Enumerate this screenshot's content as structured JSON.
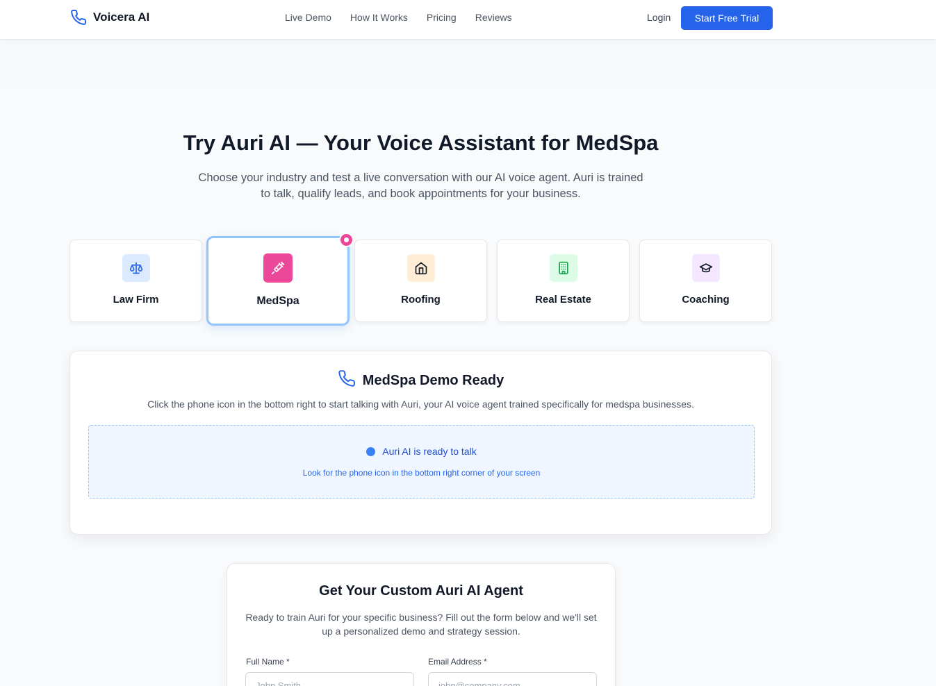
{
  "header": {
    "brand": "Voicera AI",
    "nav": [
      "Live Demo",
      "How It Works",
      "Pricing",
      "Reviews"
    ],
    "login": "Login",
    "cta": "Start Free Trial"
  },
  "hero": {
    "title": "Try Auri AI — Your Voice Assistant for MedSpa",
    "subtitle": "Choose your industry and test a live conversation with our AI voice agent. Auri is trained to talk, qualify leads, and book appointments for your business."
  },
  "industries": [
    {
      "label": "Law Firm",
      "icon": "scales-icon",
      "bg": "#dbeafe",
      "fg": "#2563eb"
    },
    {
      "label": "MedSpa",
      "icon": "syringe-icon",
      "bg": "#ec4899",
      "fg": "#ffffff",
      "selected": true
    },
    {
      "label": "Roofing",
      "icon": "home-icon",
      "bg": "#ffedd5",
      "fg": "#111827"
    },
    {
      "label": "Real Estate",
      "icon": "building-icon",
      "bg": "#dcfce7",
      "fg": "#16a34a"
    },
    {
      "label": "Coaching",
      "icon": "graduation-cap-icon",
      "bg": "#f3e8ff",
      "fg": "#111827"
    }
  ],
  "demo": {
    "title": "MedSpa Demo Ready",
    "description": "Click the phone icon in the bottom right to start talking with Auri, your AI voice agent trained specifically for medspa businesses.",
    "status": "Auri AI is ready to talk",
    "hint": "Look for the phone icon in the bottom right corner of your screen"
  },
  "form": {
    "title": "Get Your Custom Auri AI Agent",
    "description": "Ready to train Auri for your specific business? Fill out the form below and we'll set up a personalized demo and strategy session.",
    "full_name_label": "Full Name *",
    "full_name_placeholder": "John Smith",
    "email_label": "Email Address *",
    "email_placeholder": "john@company.com"
  },
  "colors": {
    "primary": "#2563eb",
    "accent_pink": "#ec4899",
    "selected_border": "#93c5fd"
  }
}
